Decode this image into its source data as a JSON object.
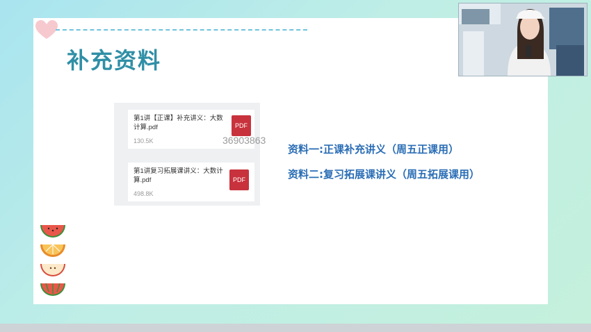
{
  "slide": {
    "title": "补充资料",
    "descriptions": [
      "资料一:正课补充讲义（周五正课用）",
      "资料二:复习拓展课讲义（周五拓展课用）"
    ]
  },
  "files": [
    {
      "name": "第1讲【正课】补充讲义：大数计算.pdf",
      "size": "130.5K",
      "icon_label": "PDF"
    },
    {
      "name": "第1讲复习拓展课讲义：大数计算.pdf",
      "size": "498.8K",
      "icon_label": "PDF"
    }
  ],
  "watermark": "36903863",
  "colors": {
    "title": "#2f8fa6",
    "description": "#2a6db5",
    "pdf_icon": "#c8323c"
  },
  "icons": [
    "heart-icon",
    "watermelon-icon",
    "orange-icon",
    "apple-icon",
    "watermelon-icon",
    "webcam-video"
  ]
}
